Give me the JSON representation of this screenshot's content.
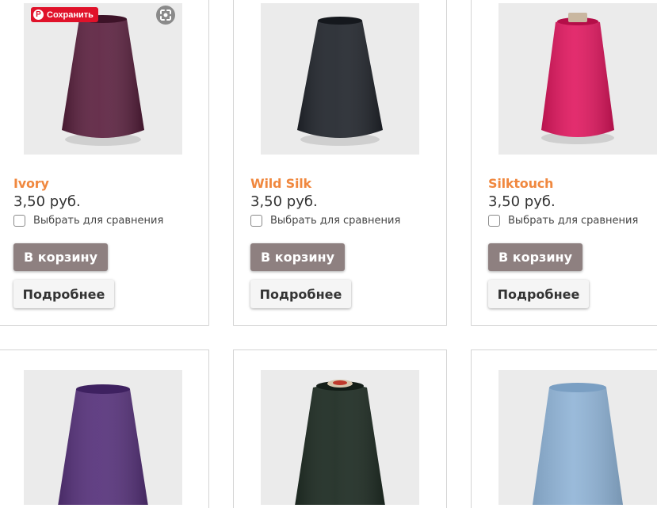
{
  "pinterest": {
    "save_label": "Сохранить",
    "logo_glyph": "P",
    "icon": "pinterest-icon"
  },
  "visual_search": {
    "icon": "visual-search-icon"
  },
  "products": [
    {
      "name": "Ivory",
      "price": "3,50 руб.",
      "compare_label": "Выбрать для сравнения",
      "cart_label": "В корзину",
      "details_label": "Подробнее",
      "yarn_color": "#5b1f3e"
    },
    {
      "name": "Wild Silk",
      "price": "3,50 руб.",
      "compare_label": "Выбрать для сравнения",
      "cart_label": "В корзину",
      "details_label": "Подробнее",
      "yarn_color": "#22262d"
    },
    {
      "name": "Silktouch",
      "price": "3,50 руб.",
      "compare_label": "Выбрать для сравнения",
      "cart_label": "В корзину",
      "details_label": "Подробнее",
      "yarn_color": "#e0165e"
    },
    {
      "yarn_color": "#55307a"
    },
    {
      "yarn_color": "#1d2b22"
    },
    {
      "yarn_color": "#8fb3d6"
    }
  ],
  "colors": {
    "product_name": "#f0883f",
    "cart_button": "#8e8080",
    "details_button": "#f5f5f5",
    "pinterest_red": "#e0122a"
  }
}
